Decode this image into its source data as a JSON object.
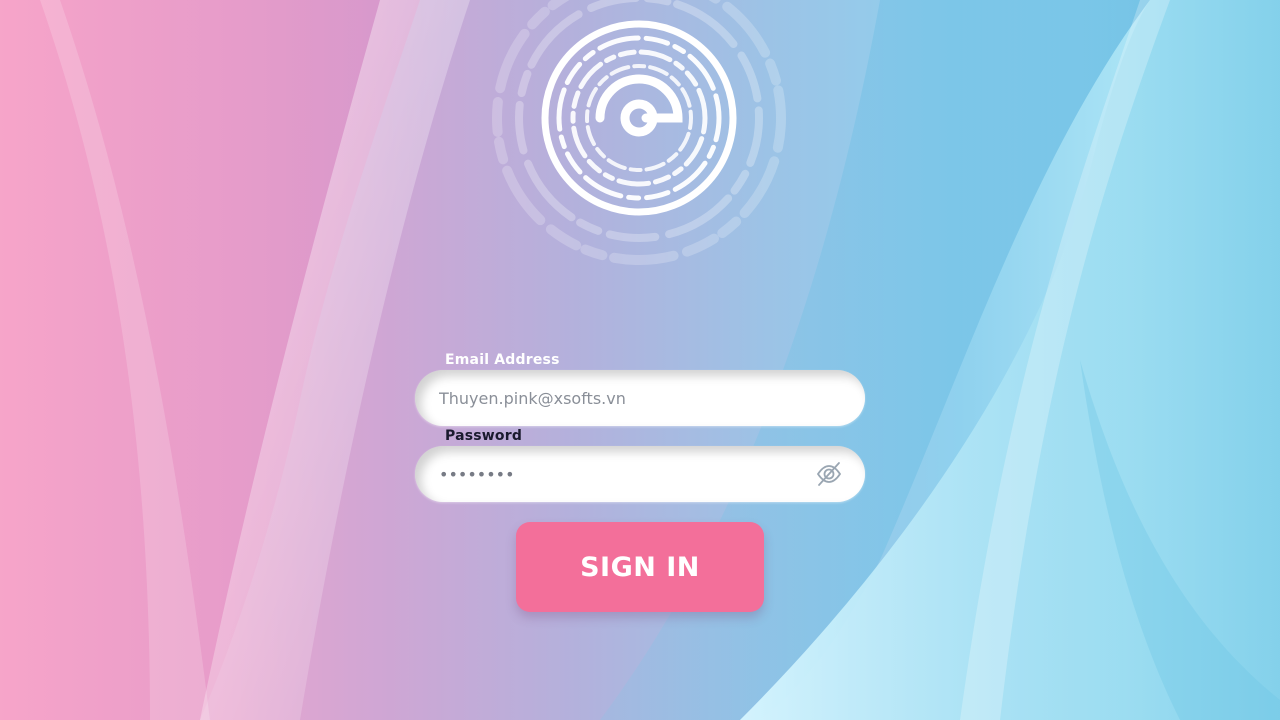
{
  "colors": {
    "button_bg": "#f36f9a",
    "input_bg": "#ffffff",
    "label_email": "#ffffff",
    "label_password": "#1a1a2e"
  },
  "logo": {
    "icon": "circular-g-logo-icon"
  },
  "form": {
    "email": {
      "label": "Email Address",
      "placeholder": "Thuyen.pink@xsofts.vn",
      "value": ""
    },
    "password": {
      "label": "Password",
      "value": "••••••••",
      "toggle_icon": "eye-off-icon"
    },
    "submit_label": "SIGN IN"
  }
}
